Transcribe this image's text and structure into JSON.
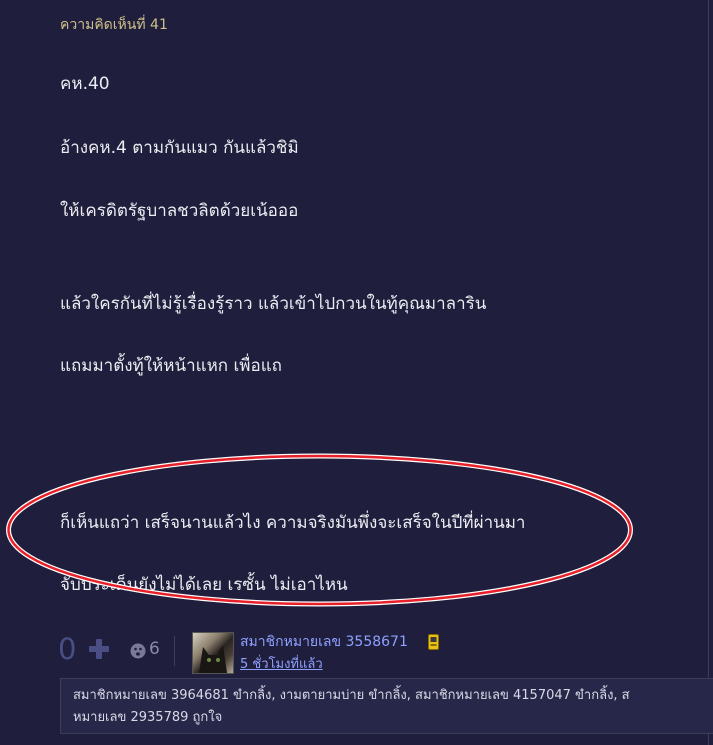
{
  "comment": {
    "number_label": "ความคิดเห็นที่ 41",
    "lines": [
      "คห.40",
      "อ้างคห.4   ตามกันแมว   กันแล้วชิมิ",
      "ให้เครดิตรัฐบาลชวลิตด้วยเน้อออ",
      "แล้วใครกันที่ไม่รู้เรื่องรู้ราว   แล้วเข้าไปกวนในทู้คุณมาลาริน",
      "แถมมาตั้งทู้ให้หน้าแหก   เพื่อแถ",
      "ก็เห็นแถว่า   เสร็จนานแล้วไง    ความจริงมันพึ่งจะเสร็จในปีที่ผ่านมา",
      "จับประเด็นยังไม่ได้เลย    เรซั้น    ไม่เอาไหน"
    ]
  },
  "footer": {
    "vote_count": "0",
    "emote_count": "6",
    "member_name": "สมาชิกหมายเลข 3558671",
    "timestamp": "5 ชั่วโมงที่แล้ว"
  },
  "likes": {
    "line1": "สมาชิกหมายเลข 3964681 ขำกลิ้ง, งามตายามบ่าย ขำกลิ้ง, สมาชิกหมายเลข 4157047 ขำกลิ้ง, ส",
    "line2": "หมายเลข 2935789 ถูกใจ"
  },
  "colors": {
    "background": "#1f1f3d",
    "text": "#ececf2",
    "comment_number": "#cfc08a",
    "link": "#8fa0ff",
    "highlight_oval": "#e8202a",
    "vote_count": "#4b4e84"
  },
  "icons": {
    "plus": "plus-icon",
    "emote": "emote-icon",
    "badge": "member-badge-icon"
  }
}
